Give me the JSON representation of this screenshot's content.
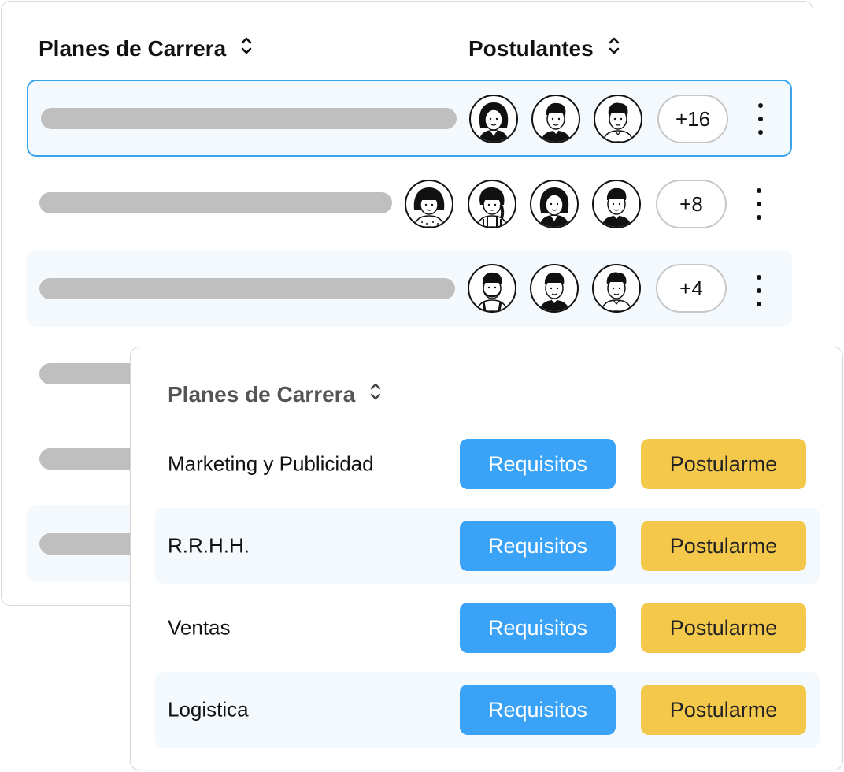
{
  "back_table": {
    "col_plans": "Planes de Carrera",
    "col_applicants": "Postulantes",
    "rows": [
      {
        "more_count": "+16"
      },
      {
        "more_count": "+8"
      },
      {
        "more_count": "+4"
      }
    ]
  },
  "front_table": {
    "title": "Planes de Carrera",
    "requirements_label": "Requisitos",
    "apply_label": "Postularme",
    "rows": [
      {
        "name": "Marketing y Publicidad"
      },
      {
        "name": "R.R.H.H."
      },
      {
        "name": "Ventas"
      },
      {
        "name": "Logistica"
      }
    ]
  },
  "colors": {
    "primary_blue": "#3aa3f7",
    "accent_yellow": "#f3c84b",
    "selected_border": "#3aa3ef",
    "row_shade": "#f4f9fe",
    "placeholder_bar": "#bfbfbf"
  },
  "icons": [
    "sort-icon",
    "avatar-woman-icon",
    "avatar-man-icon",
    "avatar-bearded-man-icon",
    "kebab-menu-icon"
  ]
}
